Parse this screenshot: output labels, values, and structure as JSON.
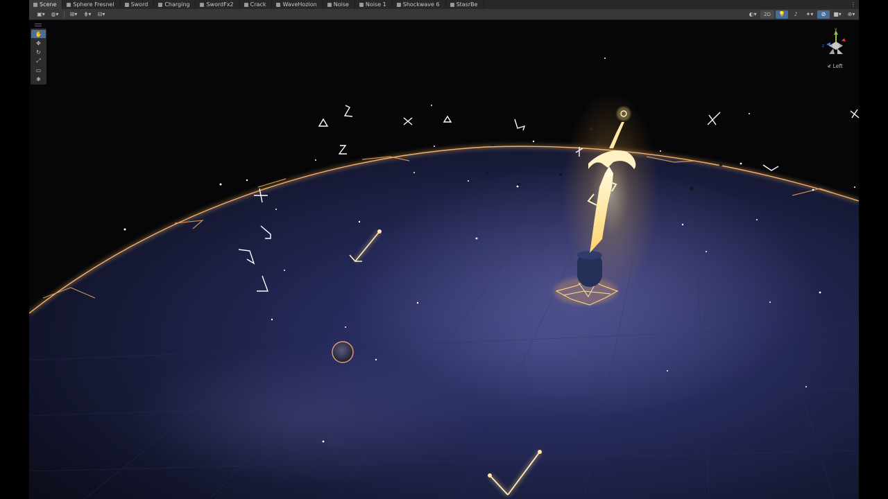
{
  "tabs": [
    {
      "label": "Scene",
      "active": true
    },
    {
      "label": "Sphere Fresnel"
    },
    {
      "label": "Sword"
    },
    {
      "label": "Charging"
    },
    {
      "label": "SwordFx2"
    },
    {
      "label": "Crack"
    },
    {
      "label": "WaveHozion"
    },
    {
      "label": "Noise"
    },
    {
      "label": "Noise 1"
    },
    {
      "label": "Shockwave 6"
    },
    {
      "label": "StasrBe"
    }
  ],
  "toolbar": {
    "mode_2d_label": "2D",
    "tab_menu_icon": "more-vert-icon"
  },
  "tools": [
    {
      "name": "hand-tool",
      "icon": "✋",
      "active": true
    },
    {
      "name": "move-tool",
      "icon": "✥"
    },
    {
      "name": "rotate-tool",
      "icon": "↻"
    },
    {
      "name": "scale-tool",
      "icon": "⤢"
    },
    {
      "name": "rect-tool",
      "icon": "▭"
    },
    {
      "name": "transform-tool",
      "icon": "❋"
    }
  ],
  "gizmo": {
    "view_label": "≮ Left",
    "axis_y": "y",
    "axis_z": "z"
  },
  "colors": {
    "accent": "#4a6d95",
    "glow": "#ffd27a",
    "ring": "#e8a55a"
  }
}
